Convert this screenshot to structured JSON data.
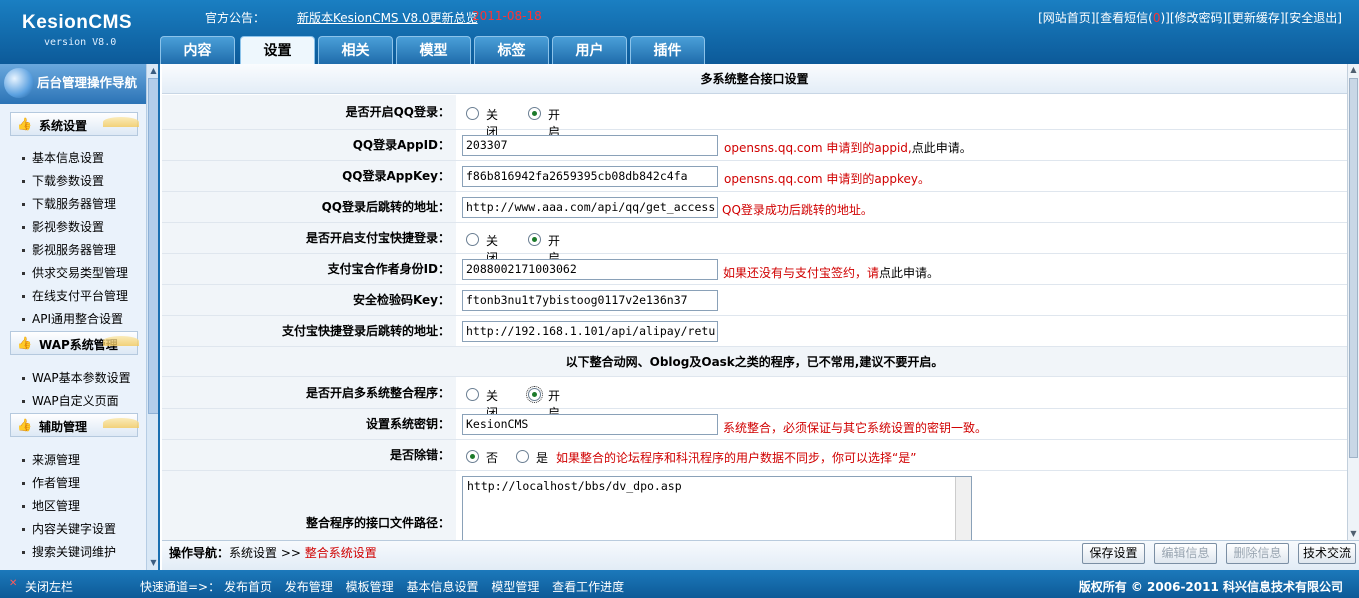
{
  "header": {
    "logo_name": "KesionCMS",
    "logo_version": "version V8.0",
    "notice_label": "官方公告：",
    "notice_link": "新版本KesionCMS V8.0更新总览",
    "notice_date": "2011-08-18",
    "top_links": {
      "home": "[网站首页]",
      "messages_pre": "[查看短信(",
      "messages_count": "0",
      "messages_post": ")]",
      "change_password": "[修改密码]",
      "refresh_cache": "[更新缓存]",
      "logout": "[安全退出]"
    },
    "tabs": [
      "内容",
      "设置",
      "相关",
      "模型",
      "标签",
      "用户",
      "插件"
    ],
    "active_tab": "设置"
  },
  "sidebar": {
    "title": "后台管理操作导航",
    "groups": [
      {
        "label": "系统设置",
        "items": [
          "基本信息设置",
          "下载参数设置",
          "下载服务器管理",
          "影视参数设置",
          "影视服务器管理",
          "供求交易类型管理",
          "在线支付平台管理",
          "API通用整合设置"
        ]
      },
      {
        "label": "WAP系统管理",
        "items": [
          "WAP基本参数设置",
          "WAP自定义页面"
        ]
      },
      {
        "label": "辅助管理",
        "items": [
          "来源管理",
          "作者管理",
          "地区管理",
          "内容关键字设置",
          "搜索关键词维护"
        ]
      }
    ]
  },
  "main": {
    "title": "多系统整合接口设置",
    "qq_login": {
      "label": "是否开启QQ登录：",
      "off": "关闭",
      "on": "开启",
      "value": "on"
    },
    "qq_appid": {
      "label": "QQ登录AppID：",
      "value": "203307",
      "hint": "opensns.qq.com 申请到的appid,",
      "hint_tail": "点此申请。"
    },
    "qq_appkey": {
      "label": "QQ登录AppKey：",
      "value": "f86b816942fa2659395cb08db842c4fa",
      "hint": "opensns.qq.com 申请到的appkey。"
    },
    "qq_redirect": {
      "label": "QQ登录后跳转的地址：",
      "value": "http://www.aaa.com/api/qq/get_access",
      "hint": "QQ登录成功后跳转的地址。"
    },
    "alipay_login": {
      "label": "是否开启支付宝快捷登录：",
      "off": "关闭",
      "on": "开启",
      "value": "on"
    },
    "alipay_partner": {
      "label": "支付宝合作者身份ID：",
      "value": "2088002171003062",
      "hint": "如果还没有与支付宝签约，请",
      "hint_tail": "点此申请。"
    },
    "alipay_key": {
      "label": "安全检验码Key：",
      "value": "ftonb3nu1t7ybistoog0117v2e136n37"
    },
    "alipay_redirect": {
      "label": "支付宝快捷登录后跳转的地址：",
      "value": "http://192.168.1.101/api/alipay/retu"
    },
    "section_note": "以下整合动网、Oblog及Oask之类的程序，已不常用,建议不要开启。",
    "multi_system": {
      "label": "是否开启多系统整合程序：",
      "off": "关闭",
      "on": "开启",
      "value": "on"
    },
    "system_key": {
      "label": "设置系统密钥：",
      "value": "KesionCMS",
      "hint": "系统整合，必须保证与其它系统设置的密钥一致。"
    },
    "debug": {
      "label": "是否除错：",
      "no": "否",
      "yes": "是",
      "value": "no",
      "hint": "如果整合的论坛程序和科汛程序的用户数据不同步，你可以选择“是”"
    },
    "api_path": {
      "label": "整合程序的接口文件路径：",
      "value": "http://localhost/bbs/dv_dpo.asp"
    }
  },
  "actionbar": {
    "crumb_label": "操作导航：",
    "crumb_parent": "系统设置",
    "crumb_sep": ">>",
    "crumb_current": "整合系统设置",
    "buttons": {
      "save": "保存设置",
      "edit": "编辑信息",
      "delete": "删除信息",
      "support": "技术交流"
    }
  },
  "footer": {
    "close_left": "关闭左栏",
    "quick_label": "快速通道=>：",
    "quick_links": [
      "发布首页",
      "发布管理",
      "模板管理",
      "基本信息设置",
      "模型管理",
      "查看工作进度"
    ],
    "copyright": "版权所有 © 2006-2011 科兴信息技术有限公司"
  }
}
